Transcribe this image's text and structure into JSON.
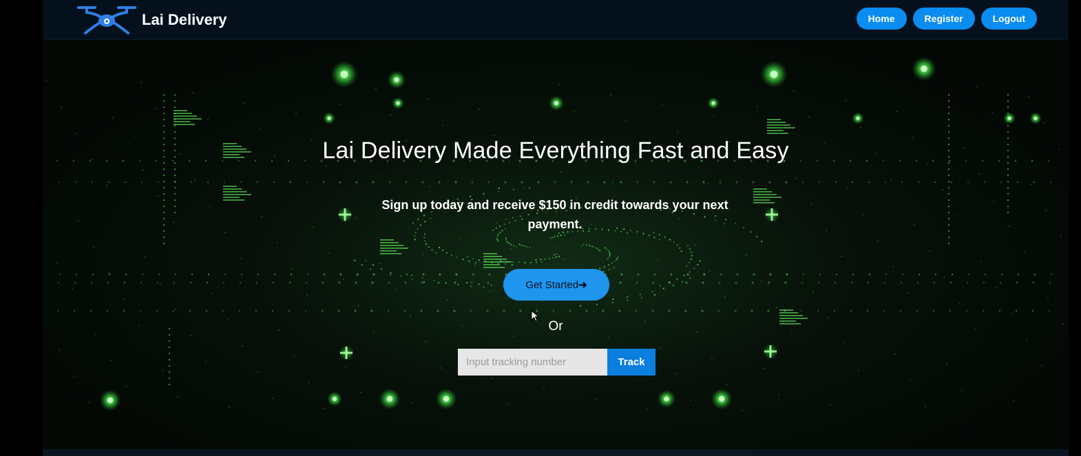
{
  "navbar": {
    "brand_name": "Lai Delivery",
    "logo_icon": "drone-icon",
    "links": [
      {
        "label": "Home"
      },
      {
        "label": "Register"
      },
      {
        "label": "Logout"
      }
    ],
    "button_color": "#0a8cf0",
    "background": "#04101c"
  },
  "hero": {
    "title": "Lai Delivery Made Everything Fast and Easy",
    "subtitle": "Sign up today and receive $150 in credit towards your next payment.",
    "cta_label": "Get Started",
    "cta_icon": "arrow-right-icon",
    "or_text": "Or",
    "background_theme": "green-digital-particles",
    "accent_green": "#6dff6a"
  },
  "tracking": {
    "placeholder": "Input tracking number",
    "value": "",
    "button_label": "Track",
    "button_color": "#0a7fdd"
  }
}
